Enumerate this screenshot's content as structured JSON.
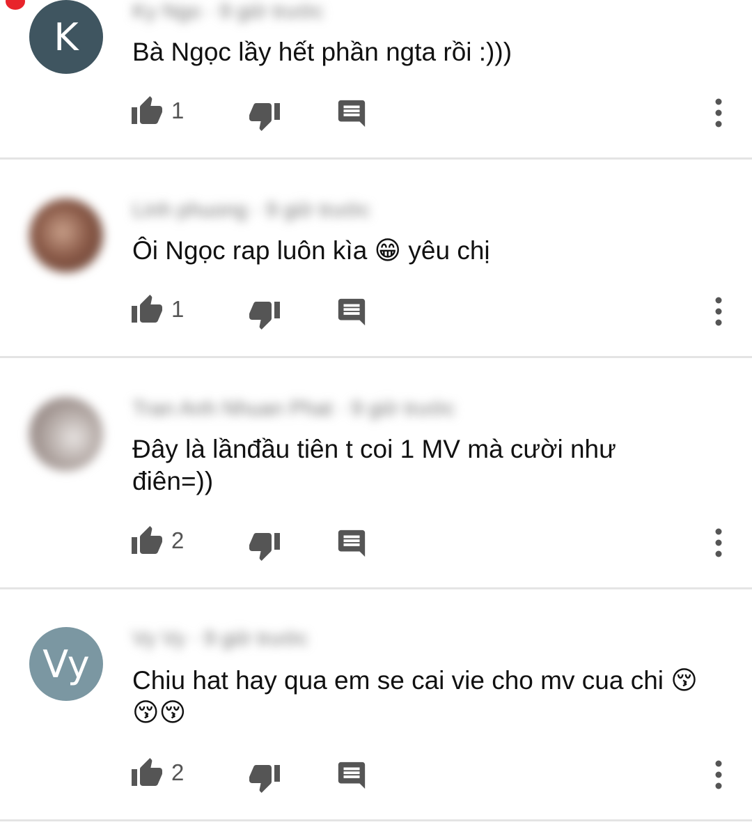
{
  "comments": [
    {
      "avatar_initial": "K",
      "avatar_color": "#3f5560",
      "author": "Ky Ngo · 9 giờ trước",
      "text": "Bà Ngọc lầy hết phần ngta rồi :)))",
      "likes": "1"
    },
    {
      "avatar_initial": "",
      "avatar_color": "#8a5a48",
      "author": "Linh phuong · 9 giờ trước",
      "text": "Ôi Ngọc rap luôn kìa 😁 yêu chị",
      "likes": "1"
    },
    {
      "avatar_initial": "",
      "avatar_color": "#9a9090",
      "author": "Tran Anh Nhuan Phat · 9 giờ trước",
      "text": "Đây là lầnđầu tiên t coi 1 MV mà cười như điên=))",
      "likes": "2"
    },
    {
      "avatar_initial": "Vy",
      "avatar_color": "#7b97a2",
      "author": "Vy Vy · 9 giờ trước",
      "text": "Chiu hat hay qua em se cai vie cho mv cua chi 😚😚😚",
      "likes": "2"
    }
  ],
  "icons": {
    "like": "thumb-up-icon",
    "dislike": "thumb-down-icon",
    "reply": "comment-icon",
    "more": "more-vertical-icon"
  },
  "colors": {
    "icon": "#555555",
    "divider": "#e4e4e4",
    "notification_dot": "#e8242b"
  }
}
